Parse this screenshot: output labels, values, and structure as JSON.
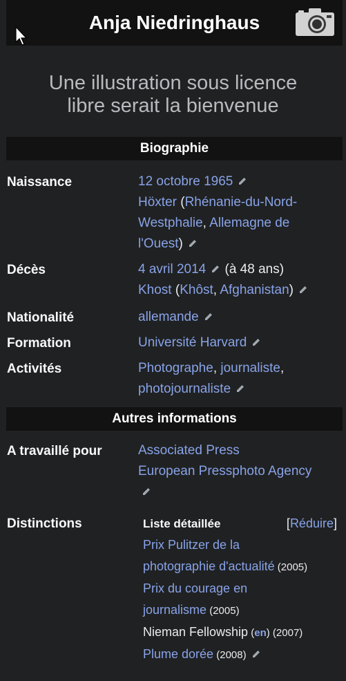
{
  "title": "Anja Niedringhaus",
  "placeholder": {
    "line1": "Une illustration sous licence",
    "line2": "libre serait la bienvenue"
  },
  "sections": {
    "bio": "Biographie",
    "other": "Autres informations"
  },
  "naissance": {
    "label": "Naissance",
    "date": "12 octobre 1965",
    "place": "Höxter",
    "paren_open": " (",
    "region1": "Rhénanie-du-Nord-",
    "region2": "Westphalie",
    "comma": ", ",
    "country1": "Allemagne de",
    "country2": "l'Ouest",
    "paren_close": ")"
  },
  "deces": {
    "label": "Décès",
    "date": "4 avril 2014",
    "age": " (à 48 ans)",
    "place": "Khost",
    "paren_open": " (",
    "region": "Khôst",
    "comma": ", ",
    "country": "Afghanistan",
    "paren_close": ")"
  },
  "nationalite": {
    "label": "Nationalité",
    "value": "allemande"
  },
  "formation": {
    "label": "Formation",
    "value": "Université Harvard"
  },
  "activites": {
    "label": "Activités",
    "a1": "Photographe",
    "sep1": ", ",
    "a2": "journaliste",
    "sep2": ",",
    "a3": "photojournaliste"
  },
  "travaille": {
    "label": "A travaillé pour",
    "v1": "Associated Press",
    "v2": "European Pressphoto Agency"
  },
  "distinctions": {
    "label": "Distinctions",
    "list_title": "Liste détaillée",
    "toggle_open": "[",
    "toggle": "Réduire",
    "toggle_close": "]",
    "d1a": "Prix Pulitzer de la",
    "d1b": "photographie d'actualité",
    "d1y": " (2005)",
    "d2a": "Prix du courage en",
    "d2b": "journalisme",
    "d2y": " (2005)",
    "d3": "Nieman Fellowship",
    "d3en_open": " (",
    "d3en": "en",
    "d3en_close": ")",
    "d3y": " (2007)",
    "d4": "Plume dorée",
    "d4y": " (2008)"
  },
  "icons": {
    "camera": "camera-icon",
    "edit": "pencil-icon",
    "cursor": "mouse-cursor-icon"
  },
  "colors": {
    "background": "#202122",
    "header": "#121212",
    "link": "#88a3e8",
    "text": "#eaecf0"
  }
}
